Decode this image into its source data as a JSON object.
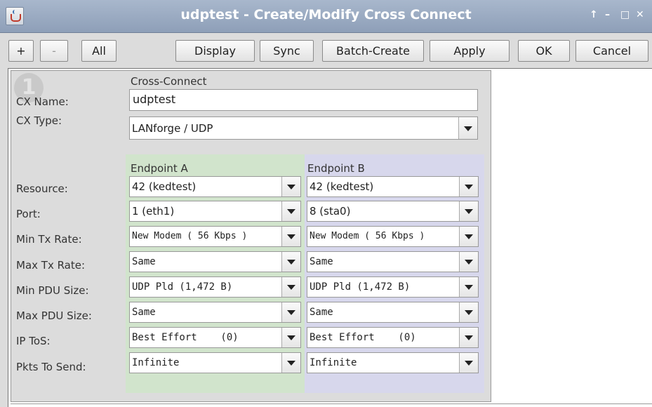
{
  "window": {
    "title": "udptest - Create/Modify Cross Connect",
    "controls": [
      "↑",
      "–",
      "□",
      "✕"
    ]
  },
  "toolbar": {
    "plus": "+",
    "minus": "-",
    "all": "All",
    "display": "Display",
    "sync": "Sync",
    "batch_create": "Batch-Create",
    "apply": "Apply",
    "ok": "OK",
    "cancel": "Cancel"
  },
  "badge": "1",
  "form": {
    "section_title": "Cross-Connect",
    "cx_name_label": "CX Name:",
    "cx_name_value": "udptest",
    "cx_type_label": "CX Type:",
    "cx_type_value": "LANforge / UDP",
    "endpoint_a": "Endpoint A",
    "endpoint_b": "Endpoint B",
    "rows": [
      {
        "label": "Resource:",
        "a": "42 (kedtest)",
        "b": "42 (kedtest)"
      },
      {
        "label": "Port:",
        "a": "1 (eth1)",
        "b": "8 (sta0)"
      },
      {
        "label": "Min Tx Rate:",
        "a": "New Modem ( 56 Kbps )",
        "b": "New Modem ( 56 Kbps )"
      },
      {
        "label": "Max Tx Rate:",
        "a": "Same",
        "b": "Same"
      },
      {
        "label": "Min PDU Size:",
        "a": "UDP Pld  (1,472 B)",
        "b": "UDP Pld  (1,472 B)"
      },
      {
        "label": "Max PDU Size:",
        "a": "Same",
        "b": "Same"
      },
      {
        "label": "IP ToS:",
        "a": "Best Effort    (0)",
        "b": "Best Effort    (0)"
      },
      {
        "label": "Pkts To Send:",
        "a": "Infinite",
        "b": "Infinite"
      }
    ]
  }
}
